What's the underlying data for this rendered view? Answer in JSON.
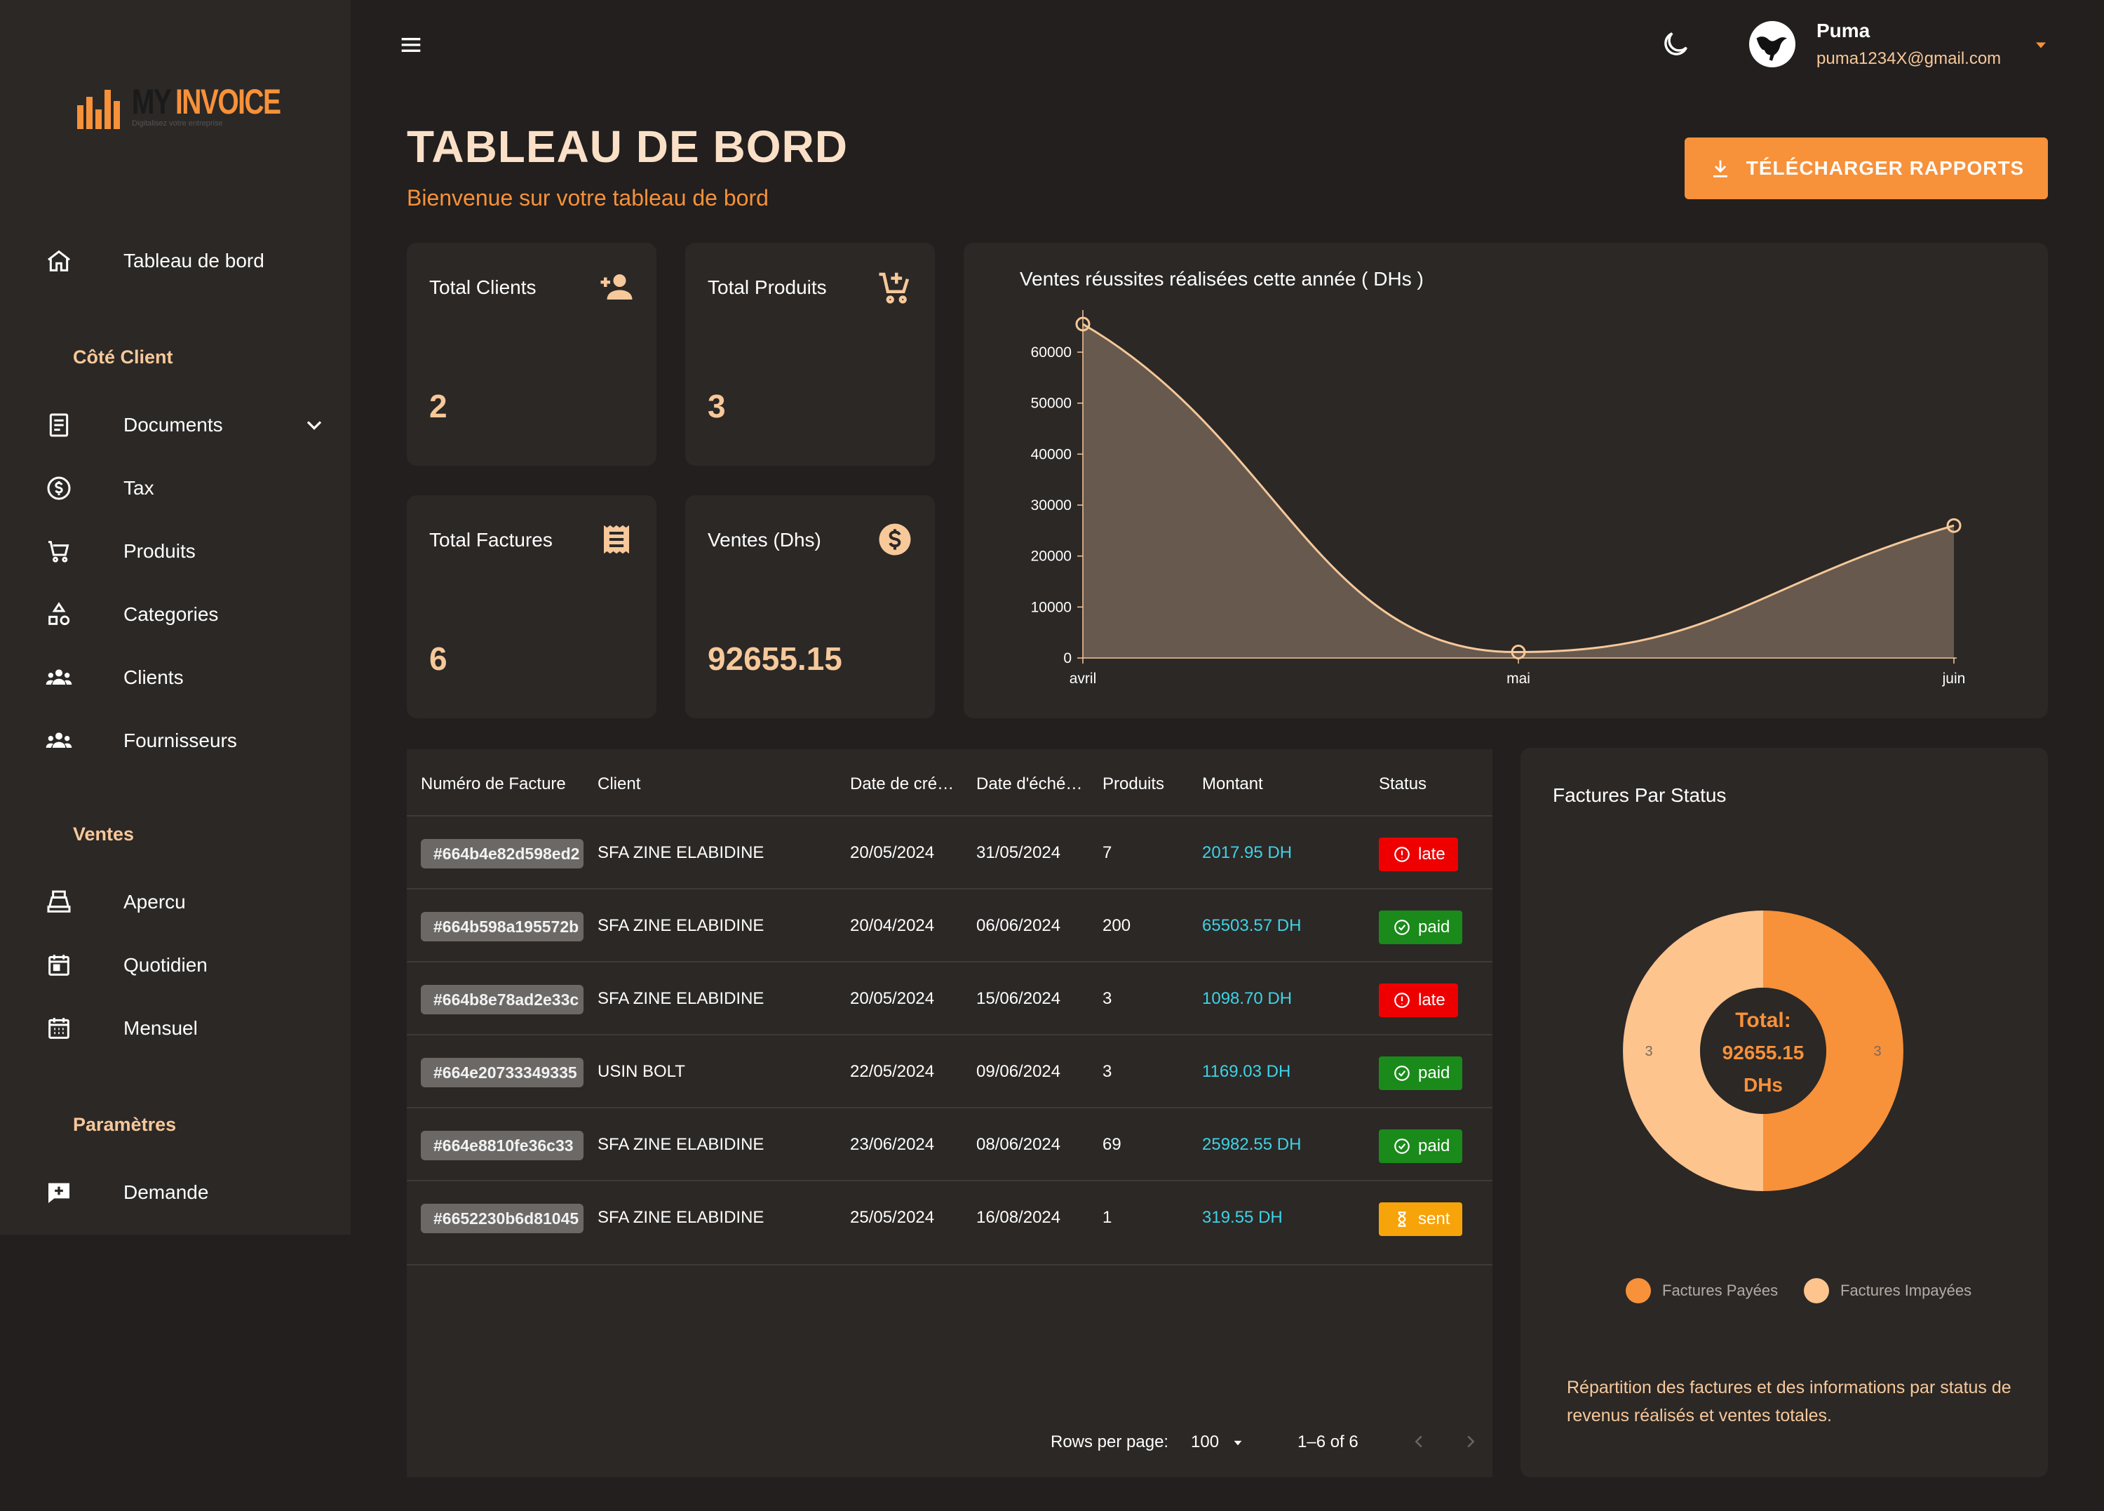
{
  "brand": {
    "word1": "MY",
    "word2": "INVOICE",
    "tagline": "Digitalisez votre entreprise"
  },
  "sidebar": {
    "home": {
      "label": "Tableau de bord"
    },
    "sections": {
      "client": "Côté Client",
      "ventes": "Ventes",
      "params": "Paramètres"
    },
    "client_items": [
      {
        "label": "Documents"
      },
      {
        "label": "Tax"
      },
      {
        "label": "Produits"
      },
      {
        "label": "Categories"
      },
      {
        "label": "Clients"
      },
      {
        "label": "Fournisseurs"
      }
    ],
    "ventes_items": [
      {
        "label": "Apercu"
      },
      {
        "label": "Quotidien"
      },
      {
        "label": "Mensuel"
      }
    ],
    "params_items": [
      {
        "label": "Demande"
      }
    ]
  },
  "user": {
    "name": "Puma",
    "email": "puma1234X@gmail.com"
  },
  "header": {
    "title": "TABLEAU DE BORD",
    "subtitle": "Bienvenue sur votre tableau de bord",
    "download_label": "TÉLÉCHARGER RAPPORTS"
  },
  "stats": [
    {
      "title": "Total Clients",
      "value": "2",
      "icon": "person-add-icon"
    },
    {
      "title": "Total Produits",
      "value": "3",
      "icon": "cart-add-icon"
    },
    {
      "title": "Total Factures",
      "value": "6",
      "icon": "receipt-icon"
    },
    {
      "title": "Ventes (Dhs)",
      "value": "92655.15",
      "icon": "dollar-icon"
    }
  ],
  "chart_data": [
    {
      "type": "area",
      "title": "Ventes réussites réalisées cette année ( DHs )",
      "categories": [
        "avril",
        "mai",
        "juin"
      ],
      "values": [
        65503.57,
        1169.03,
        25982.55
      ],
      "yticks": [
        0,
        10000,
        20000,
        30000,
        40000,
        50000,
        60000
      ],
      "ylim": [
        0,
        65503.57
      ],
      "grid": false,
      "colors": {
        "line": "#f7c89a",
        "fill": "#67594d"
      }
    },
    {
      "type": "pie",
      "title": "Factures Par Status",
      "center_label": [
        "Total:",
        "92655.15",
        "DHs"
      ],
      "slices": [
        {
          "name": "Factures Payées",
          "value": 3,
          "color": "#f7913a"
        },
        {
          "name": "Factures Impayées",
          "value": 3,
          "color": "#fdc48e"
        }
      ],
      "legend": "bottom"
    }
  ],
  "table": {
    "headers": [
      "Numéro de Facture",
      "Client",
      "Date de cré…",
      "Date d'éché…",
      "Produits",
      "Montant",
      "Status"
    ],
    "rows": [
      {
        "id": "#664b4e82d598ed2",
        "client": "SFA ZINE ELABIDINE",
        "created": "20/05/2024",
        "due": "31/05/2024",
        "products": "7",
        "amount": "2017.95 DH",
        "status": "late"
      },
      {
        "id": "#664b598a195572b",
        "client": "SFA ZINE ELABIDINE",
        "created": "20/04/2024",
        "due": "06/06/2024",
        "products": "200",
        "amount": "65503.57 DH",
        "status": "paid"
      },
      {
        "id": "#664b8e78ad2e33c",
        "client": "SFA ZINE ELABIDINE",
        "created": "20/05/2024",
        "due": "15/06/2024",
        "products": "3",
        "amount": "1098.70 DH",
        "status": "late"
      },
      {
        "id": "#664e20733349335",
        "client": "USIN BOLT",
        "created": "22/05/2024",
        "due": "09/06/2024",
        "products": "3",
        "amount": "1169.03 DH",
        "status": "paid"
      },
      {
        "id": "#664e8810fe36c33",
        "client": "SFA ZINE ELABIDINE",
        "created": "23/06/2024",
        "due": "08/06/2024",
        "products": "69",
        "amount": "25982.55 DH",
        "status": "paid"
      },
      {
        "id": "#6652230b6d81045",
        "client": "SFA ZINE ELABIDINE",
        "created": "25/05/2024",
        "due": "16/08/2024",
        "products": "1",
        "amount": "319.55 DH",
        "status": "sent"
      }
    ],
    "status_colors": {
      "late": "#ee0000",
      "paid": "#1a8a1a",
      "sent": "#f7a30a"
    },
    "pagination": {
      "rows_label": "Rows per page:",
      "rows_value": "100",
      "range": "1–6 of 6"
    }
  },
  "donut_desc": "Répartition des factures et des informations par status de revenus réalisés et ventes totales."
}
